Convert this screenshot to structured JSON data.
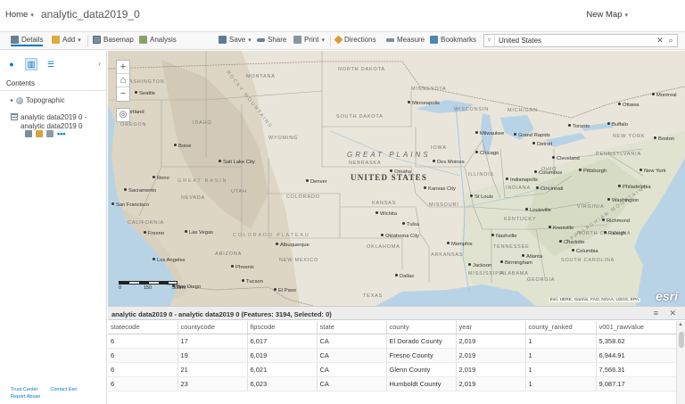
{
  "header": {
    "home_label": "Home",
    "app_title": "analytic_data2019_0",
    "new_map_label": "New Map"
  },
  "toolbar": {
    "details": "Details",
    "add": "Add",
    "basemap": "Basemap",
    "analysis": "Analysis",
    "save": "Save",
    "share": "Share",
    "print": "Print",
    "directions": "Directions",
    "measure": "Measure",
    "bookmarks": "Bookmarks"
  },
  "search": {
    "value": "United States"
  },
  "left_panel": {
    "contents_title": "Contents",
    "layers": [
      {
        "label": "Topographic"
      },
      {
        "label_line1": "analytic data2019 0 -",
        "label_line2": "analytic data2019 0"
      }
    ],
    "more_label": "•••",
    "footer": {
      "trust_center": "Trust Center",
      "contact": "Contact Esri",
      "report_abuse": "Report Abuse"
    }
  },
  "map": {
    "country_label": "UNITED STATES",
    "region_label": "GREAT PLAINS",
    "mountain_labels": [
      "ROCKY MOUNTAINS",
      "GREAT BASIN",
      "APPALACHIAN MOUNTAINS",
      "COLORADO PLATEAU"
    ],
    "states": [
      "WASHINGTON",
      "MONTANA",
      "NORTH DAKOTA",
      "MINNESOTA",
      "WISCONSIN",
      "MICHIGAN",
      "OREGON",
      "IDAHO",
      "WYOMING",
      "SOUTH DAKOTA",
      "IOWA",
      "NEBRASKA",
      "NEVADA",
      "UTAH",
      "COLORADO",
      "KANSAS",
      "MISSOURI",
      "ILLINOIS",
      "INDIANA",
      "OHIO",
      "PENNSYLVANIA",
      "CALIFORNIA",
      "ARIZONA",
      "NEW MEXICO",
      "OKLAHOMA",
      "ARKANSAS",
      "TENNESSEE",
      "KENTUCKY",
      "VIRGINIA",
      "NORTH CAROLINA",
      "SOUTH CAROLINA",
      "MISSISSIPPI",
      "ALABAMA",
      "GEORGIA",
      "TEXAS",
      "NEW YORK"
    ],
    "cities": [
      "Seattle",
      "Portland",
      "Boise",
      "Salt Lake City",
      "Denver",
      "Las Vegas",
      "Los Angeles",
      "San Diego",
      "Phoenix",
      "Tucson",
      "Albuquerque",
      "Fresno",
      "San Francisco",
      "Sacramento",
      "Reno",
      "El Paso",
      "Minneapolis",
      "Milwaukee",
      "Chicago",
      "Detroit",
      "Kansas City",
      "St Louis",
      "Indianapolis",
      "Columbus",
      "Cincinnati",
      "Pittsburgh",
      "Toronto",
      "Ottawa",
      "Montreal",
      "Boston",
      "New York",
      "Philadelphia",
      "Washington",
      "Richmond",
      "Nashville",
      "Louisville",
      "Memphis",
      "Atlanta",
      "Charlotte",
      "Raleigh",
      "Oklahoma City",
      "Tulsa",
      "Dallas",
      "Grand Rapids",
      "Buffalo",
      "Cleveland",
      "Omaha",
      "Des Moines",
      "Wichita",
      "Knoxville",
      "Birmingham",
      "Jackson",
      "Columbia"
    ],
    "scale_labels": [
      "0",
      "150",
      "300mi"
    ],
    "attribution": "Esri, HERE, Garmin, FAO, NOAA, USGS, EPA",
    "logo": "esri",
    "zoom_in": "+",
    "zoom_out": "−",
    "colors": {
      "land": "#e9e5da",
      "water": "#b9d3e6",
      "mountain": "#c9c3b2",
      "green": "#d7ddc7"
    }
  },
  "table": {
    "title": "analytic data2019 0 - analytic data2019 0 (Features: 3194, Selected: 0)",
    "columns": [
      "statecode",
      "countycode",
      "fipscode",
      "state",
      "county",
      "year",
      "county_ranked",
      "v001_rawvalue"
    ],
    "rows": [
      [
        "6",
        "17",
        "6,017",
        "CA",
        "El Dorado County",
        "2,019",
        "1",
        "5,358.62"
      ],
      [
        "6",
        "19",
        "6,019",
        "CA",
        "Fresno County",
        "2,019",
        "1",
        "6,944.91"
      ],
      [
        "6",
        "21",
        "6,021",
        "CA",
        "Glenn County",
        "2,019",
        "1",
        "7,566.31"
      ],
      [
        "6",
        "23",
        "6,023",
        "CA",
        "Humboldt County",
        "2,019",
        "1",
        "9,087.17"
      ]
    ]
  }
}
